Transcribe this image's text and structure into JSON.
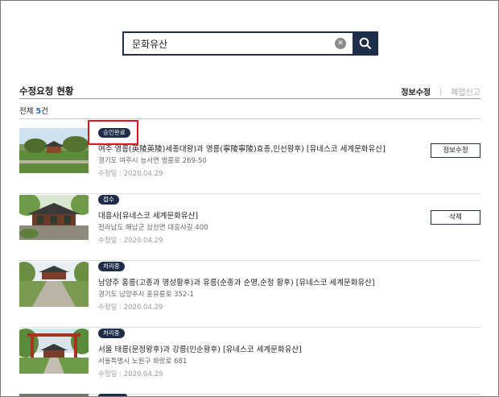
{
  "search": {
    "value": "문화유산",
    "placeholder": ""
  },
  "section": {
    "title": "수정요청 현황"
  },
  "tabs": {
    "active": "정보수정",
    "separator": "|",
    "inactive": "폐업신고"
  },
  "count": {
    "prefix": "전체 ",
    "number": "5",
    "suffix": "건"
  },
  "items": [
    {
      "status": "승인완료",
      "title": "여주 영릉(英陵英陵)세종대왕)과 영릉(寧陵寧陵)효종,인선왕후) [유네스코 세계문화유산]",
      "address": "경기도 여주시 능서면 영릉로 269-50",
      "date": "수정일 : 2020.04.29",
      "action": "정보수정"
    },
    {
      "status": "접수",
      "title": "대흥사[유네스코 세계문화유산]",
      "address": "전라남도 해남군 삼산면 대흥사길 400",
      "date": "수정일 : 2020.04.29",
      "action": "삭제"
    },
    {
      "status": "처리중",
      "title": "남양주 홍릉(고종과 명성황후)과 유릉(순종과 순명,순정 황후) [유네스코 세계문화유산]",
      "address": "경기도 남양주시 홍유릉로 352-1",
      "date": "수정일 : 2020.04.29",
      "action": ""
    },
    {
      "status": "처리중",
      "title": "서울 태릉(문정왕후)과 강릉(인순왕후) [유네스코 세계문화유산]",
      "address": "서울특별시 노원구 화랑로 681",
      "date": "수정일 : 2020.04.29",
      "action": ""
    }
  ],
  "colors": {
    "navy": "#1e2d4a",
    "accent_blue": "#2a6bc2",
    "highlight_red": "#e0141b"
  }
}
